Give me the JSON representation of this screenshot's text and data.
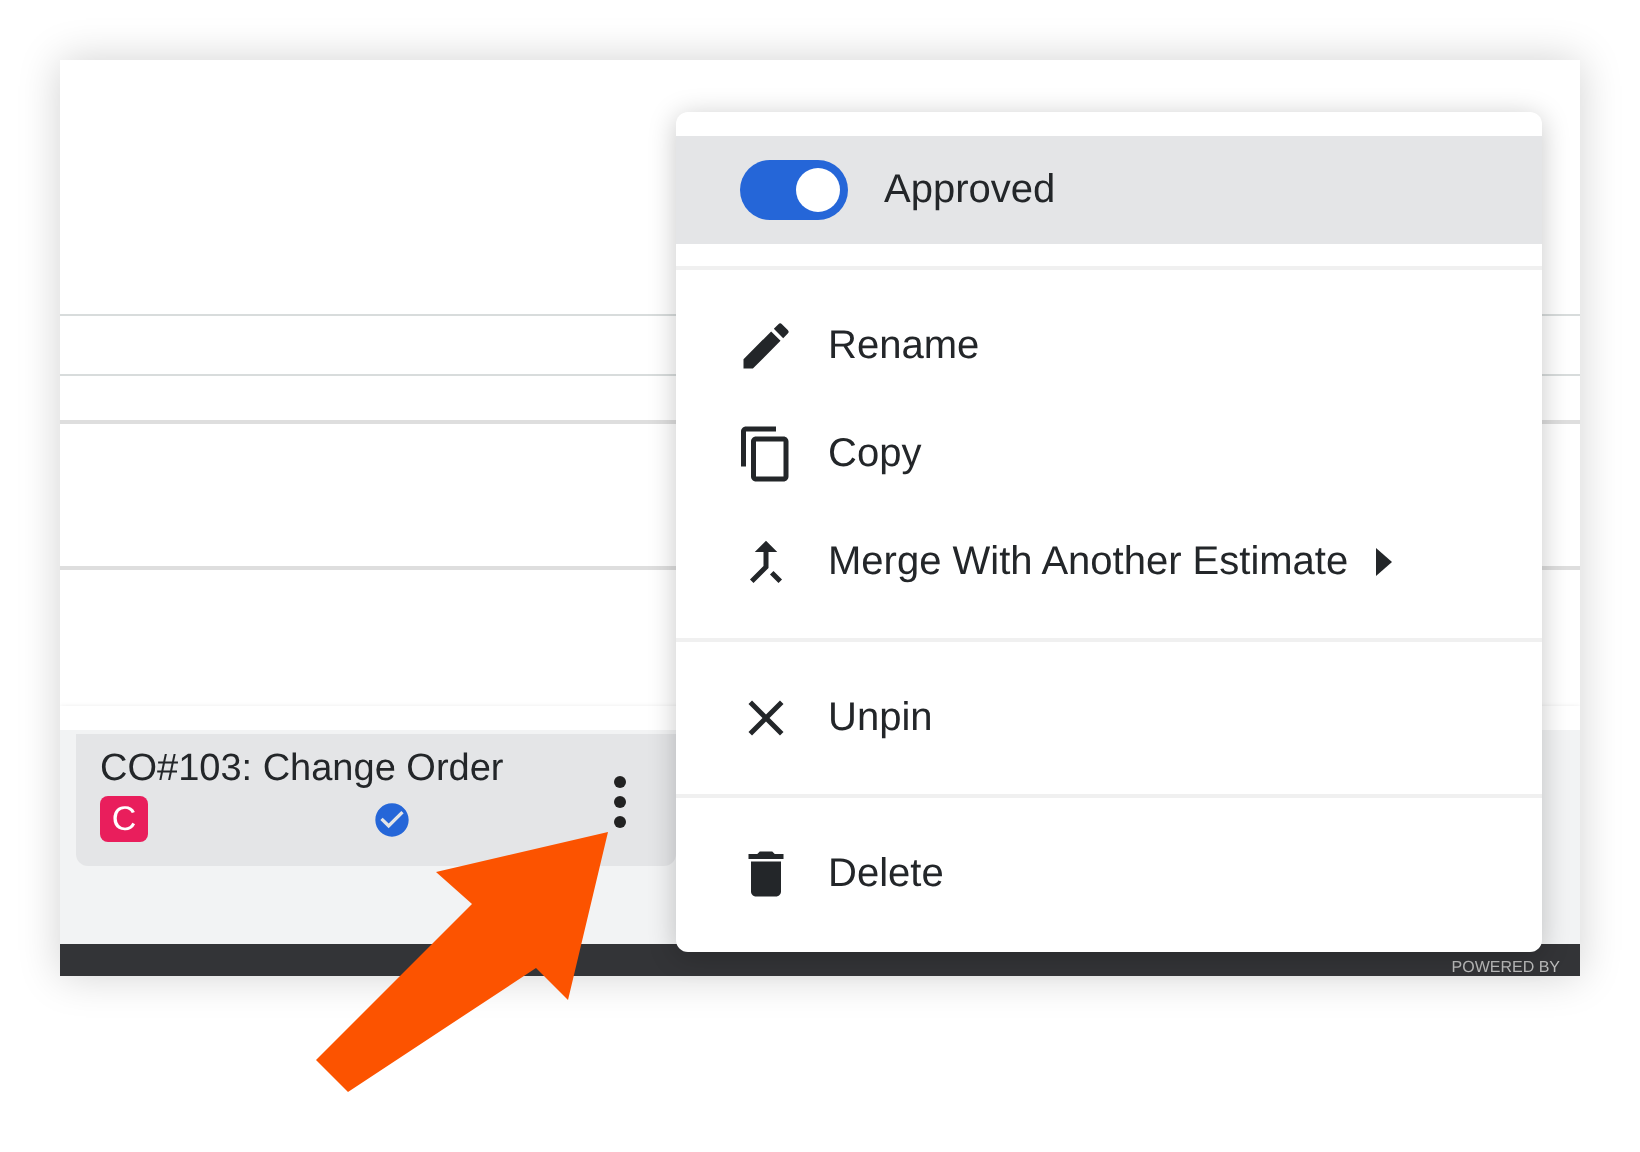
{
  "card": {
    "title": "CO#103: Change Order",
    "badge": "C",
    "verified": true
  },
  "menu": {
    "items": [
      {
        "kind": "toggle",
        "label": "Approved",
        "on": true,
        "selected": true
      },
      {
        "kind": "divider"
      },
      {
        "kind": "action",
        "label": "Rename",
        "submenu": false,
        "selected": false
      },
      {
        "kind": "action",
        "label": "Copy",
        "submenu": false,
        "selected": false
      },
      {
        "kind": "action",
        "label": "Merge With Another Estimate",
        "submenu": true,
        "selected": false
      },
      {
        "kind": "divider"
      },
      {
        "kind": "action",
        "label": "Unpin",
        "submenu": false,
        "selected": false
      },
      {
        "kind": "divider"
      },
      {
        "kind": "action",
        "label": "Delete",
        "submenu": false,
        "selected": false
      }
    ]
  },
  "footer": {
    "text": "POWERED BY"
  }
}
